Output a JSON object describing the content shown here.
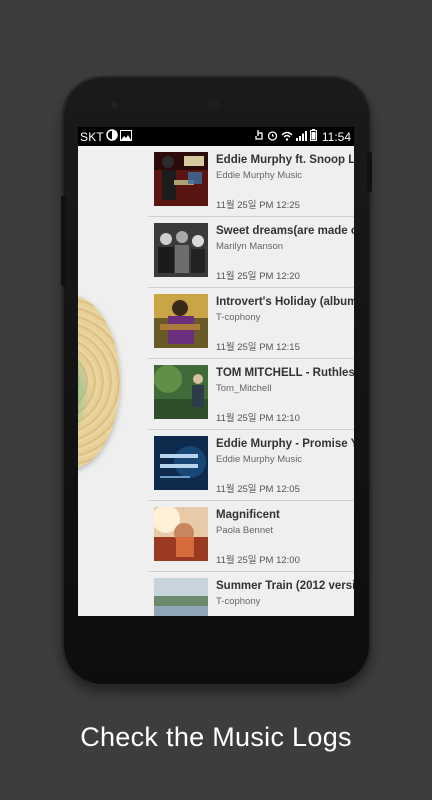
{
  "status_bar": {
    "carrier": "SKT",
    "time": "11:54"
  },
  "logs": [
    {
      "title": "Eddie Murphy ft. Snoop Lio",
      "artist": "Eddie Murphy Music",
      "time": "11월 25일 PM 12:25"
    },
    {
      "title": "Sweet dreams(are made of",
      "artist": "Marilyn Manson",
      "time": "11월 25일 PM 12:20"
    },
    {
      "title": "Introvert's Holiday (album",
      "artist": "T-cophony",
      "time": "11월 25일 PM 12:15"
    },
    {
      "title": "TOM MITCHELL - Ruthless",
      "artist": "Tom_Mitchell",
      "time": "11월 25일 PM 12:10"
    },
    {
      "title": "Eddie Murphy - Promise Yo",
      "artist": "Eddie Murphy Music",
      "time": "11월 25일 PM 12:05"
    },
    {
      "title": "Magnificent",
      "artist": "Paola Bennet",
      "time": "11월 25일 PM 12:00"
    },
    {
      "title": "Summer Train (2012 versi",
      "artist": "T-cophony",
      "time": ""
    }
  ],
  "caption": "Check the Music Logs"
}
